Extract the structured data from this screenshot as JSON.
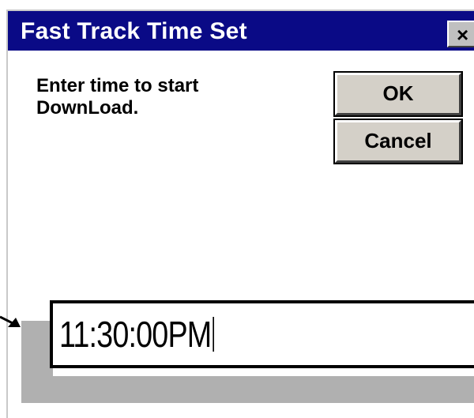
{
  "dialog": {
    "title": "Fast Track Time Set",
    "close_label": "×",
    "prompt": "Enter time to start DownLoad.",
    "ok_label": "OK",
    "cancel_label": "Cancel"
  },
  "time_field": {
    "value": "11:30:00PM"
  },
  "colors": {
    "titlebar": "#0a0a86",
    "button_face": "#d4d0c8",
    "shadow": "#b0b0b0"
  },
  "icons": {
    "close": "close-icon",
    "pointer": "pointer-arrow-icon"
  }
}
